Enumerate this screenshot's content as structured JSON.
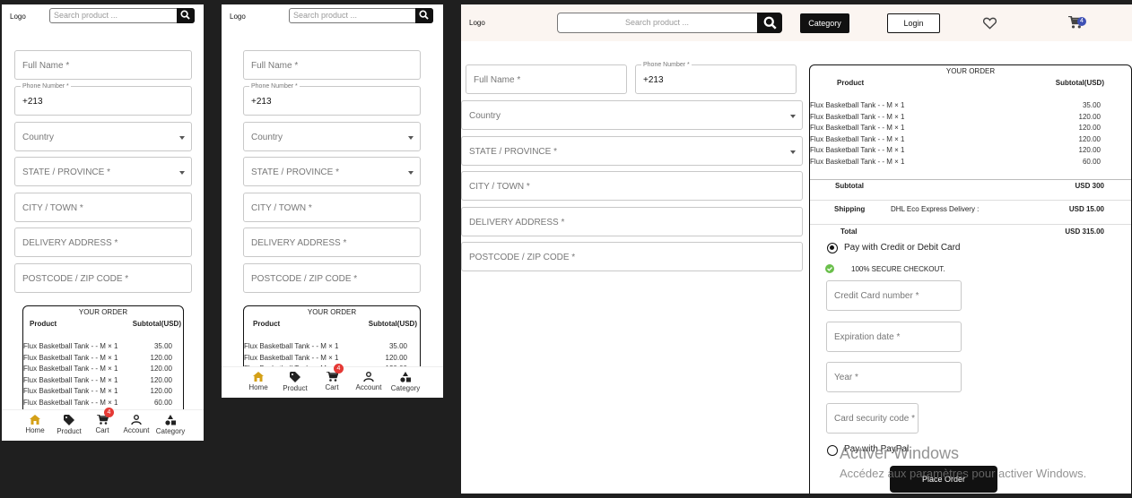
{
  "header": {
    "logo": "Logo",
    "search_placeholder": "Search product ...",
    "category_label": "Category",
    "login_label": "Login",
    "cart_count": "4"
  },
  "form": {
    "full_name": "Full Name *",
    "phone_label": "Phone Number *",
    "phone_value": "+213",
    "country": "Country",
    "state": "STATE / PROVINCE *",
    "city": "CITY / TOWN *",
    "address": "DELIVERY ADDRESS *",
    "postcode": "POSTCODE / ZIP CODE *"
  },
  "order": {
    "title": "YOUR ORDER",
    "col_product": "Product",
    "col_subtotal": "Subtotal(USD)",
    "items": [
      {
        "name": "Flux Basketball Tank - - M × 1",
        "price": "35.00"
      },
      {
        "name": "Flux Basketball Tank - - M × 1",
        "price": "120.00"
      },
      {
        "name": "Flux Basketball Tank - - M × 1",
        "price": "120.00"
      },
      {
        "name": "Flux Basketball Tank - - M × 1",
        "price": "120.00"
      },
      {
        "name": "Flux Basketball Tank - - M × 1",
        "price": "120.00"
      },
      {
        "name": "Flux Basketball Tank - - M × 1",
        "price": "60.00"
      }
    ],
    "subtotal_label": "Subtotal",
    "subtotal_value": "USD 300",
    "shipping_label": "Shipping",
    "shipping_method": "DHL Eco Express Delivery :",
    "shipping_value": "USD 15.00",
    "total_label": "Total",
    "total_value": "USD 315.00"
  },
  "payment": {
    "card_option": "Pay with Credit or Debit Card",
    "secure": "100% SECURE CHECKOUT.",
    "card_number": "Credit Card number *",
    "expiration": "Expiration date *",
    "year": "Year *",
    "security_code": "Card security code *",
    "paypal_option": "Pay with PayPal",
    "place_order": "Place Order"
  },
  "bottom_nav": {
    "home": "Home",
    "product": "Product",
    "cart": "Cart",
    "account": "Account",
    "category": "Category",
    "cart_count": "4"
  },
  "watermark": {
    "title": "Activer Windows",
    "subtitle": "Accédez aux paramètres pour activer Windows."
  },
  "colors": {
    "accent": "#111111",
    "home_active": "#d4a017",
    "badge": "#e53935",
    "secure_check": "#6abf4b"
  }
}
